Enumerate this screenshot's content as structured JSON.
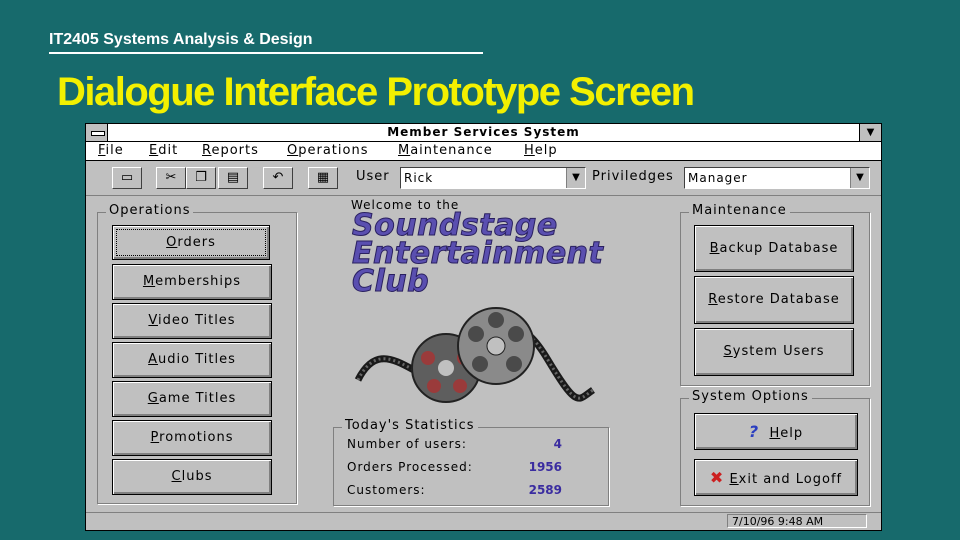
{
  "slide": {
    "course": "IT2405  Systems Analysis & Design",
    "title": "Dialogue Interface Prototype Screen"
  },
  "window": {
    "title": "Member Services System",
    "menu": [
      {
        "accel": "F",
        "rest": "ile"
      },
      {
        "accel": "E",
        "rest": "dit"
      },
      {
        "accel": "R",
        "rest": "eports"
      },
      {
        "accel": "O",
        "rest": "perations"
      },
      {
        "accel": "M",
        "rest": "aintenance"
      },
      {
        "accel": "H",
        "rest": "elp"
      }
    ],
    "toolbar": {
      "user_label": "User",
      "user_value": "Rick",
      "privileges_label": "Priviledges",
      "privileges_value": "Manager"
    },
    "operations": {
      "title": "Operations",
      "buttons": [
        {
          "accel": "O",
          "rest": "rders"
        },
        {
          "accel": "M",
          "rest": "emberships"
        },
        {
          "accel": "V",
          "rest": "ideo Titles"
        },
        {
          "accel": "A",
          "rest": "udio Titles"
        },
        {
          "accel": "G",
          "rest": "ame Titles"
        },
        {
          "accel": "P",
          "rest": "romotions"
        },
        {
          "accel": "C",
          "rest": "lubs"
        }
      ]
    },
    "center": {
      "welcome": "Welcome to the",
      "brand_line1": "Soundstage",
      "brand_line2": "Entertainment",
      "brand_line3": "Club"
    },
    "stats": {
      "title": "Today's Statistics",
      "rows": [
        {
          "label": "Number of users:",
          "value": "4"
        },
        {
          "label": "Orders Processed:",
          "value": "1956"
        },
        {
          "label": "Customers:",
          "value": "2589"
        }
      ]
    },
    "maintenance": {
      "title": "Maintenance",
      "buttons": [
        {
          "accel": "B",
          "rest": "ackup Database"
        },
        {
          "accel": "R",
          "rest": "estore Database"
        },
        {
          "accel": "S",
          "rest": "ystem Users"
        }
      ]
    },
    "system_options": {
      "title": "System Options",
      "help": {
        "accel": "H",
        "rest": "elp"
      },
      "exit": {
        "accel": "E",
        "rest": "xit and Logoff"
      }
    },
    "status_time": "7/10/96 9:48 AM"
  },
  "colors": {
    "background": "#176a6c",
    "slide_title": "#f3f000",
    "brand": "#5a4fb0",
    "stat_value": "#3a2ca0",
    "exit_icon": "#cc2020",
    "help_icon": "#2a3ec0"
  }
}
